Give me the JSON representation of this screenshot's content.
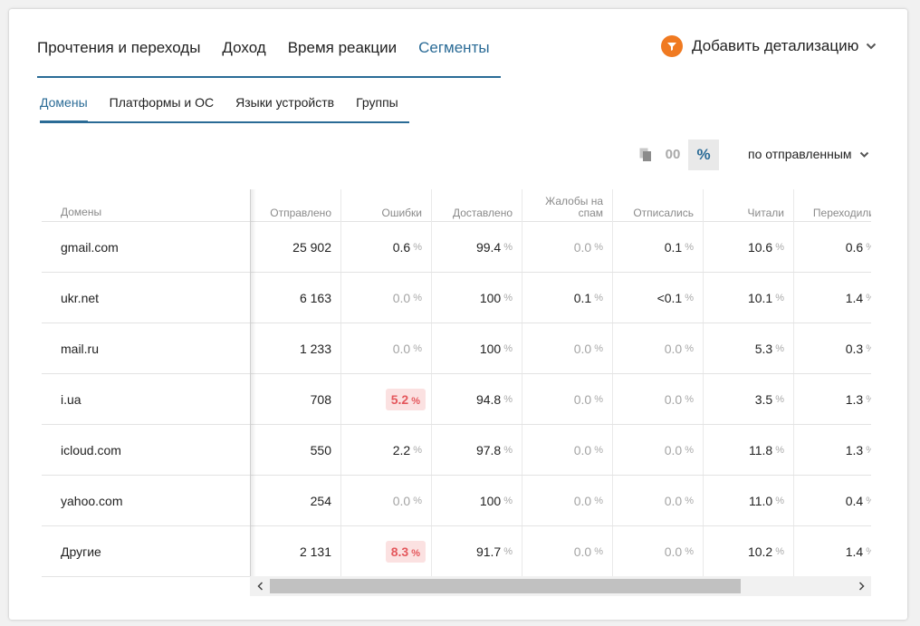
{
  "tabs": [
    {
      "label": "Прочтения и переходы",
      "active": false
    },
    {
      "label": "Доход",
      "active": false
    },
    {
      "label": "Время реакции",
      "active": false
    },
    {
      "label": "Сегменты",
      "active": true
    }
  ],
  "drilldown": {
    "label": "Добавить детализацию",
    "icon": "funnel-icon",
    "accent": "#f07a21"
  },
  "subtabs": [
    {
      "label": "Домены",
      "active": true
    },
    {
      "label": "Платформы и ОС",
      "active": false
    },
    {
      "label": "Языки устройств",
      "active": false
    },
    {
      "label": "Группы",
      "active": false
    }
  ],
  "controls": {
    "absolute_label": "00",
    "percent_label": "%",
    "sort_label": "по отправленным"
  },
  "table": {
    "first_header": "Домены",
    "headers": [
      "Отправлено",
      "Ошибки",
      "Доставлено",
      "Жалобы на спам",
      "Отписались",
      "Читали",
      "Переходили"
    ],
    "unit": "%",
    "rows": [
      {
        "domain": "gmail.com",
        "sent": "25 902",
        "errors": "0.6",
        "delivered": "99.4",
        "spam": "0.0",
        "unsub": "0.1",
        "read": "10.6",
        "clicked": "0.6"
      },
      {
        "domain": "ukr.net",
        "sent": "6 163",
        "errors": "0.0",
        "delivered": "100",
        "spam": "0.1",
        "unsub": "<0.1",
        "read": "10.1",
        "clicked": "1.4"
      },
      {
        "domain": "mail.ru",
        "sent": "1 233",
        "errors": "0.0",
        "delivered": "100",
        "spam": "0.0",
        "unsub": "0.0",
        "read": "5.3",
        "clicked": "0.3"
      },
      {
        "domain": "i.ua",
        "sent": "708",
        "errors": "5.2",
        "delivered": "94.8",
        "spam": "0.0",
        "unsub": "0.0",
        "read": "3.5",
        "clicked": "1.3",
        "errors_highlight": true
      },
      {
        "domain": "icloud.com",
        "sent": "550",
        "errors": "2.2",
        "delivered": "97.8",
        "spam": "0.0",
        "unsub": "0.0",
        "read": "11.8",
        "clicked": "1.3"
      },
      {
        "domain": "yahoo.com",
        "sent": "254",
        "errors": "0.0",
        "delivered": "100",
        "spam": "0.0",
        "unsub": "0.0",
        "read": "11.0",
        "clicked": "0.4"
      },
      {
        "domain": "Другие",
        "sent": "2 131",
        "errors": "8.3",
        "delivered": "91.7",
        "spam": "0.0",
        "unsub": "0.0",
        "read": "10.2",
        "clicked": "1.4",
        "errors_highlight": true
      }
    ]
  },
  "colors": {
    "accent": "#2a6b96",
    "error_bg": "#fbe1e1",
    "error_text": "#e4575c",
    "drill_icon": "#f07a21"
  }
}
